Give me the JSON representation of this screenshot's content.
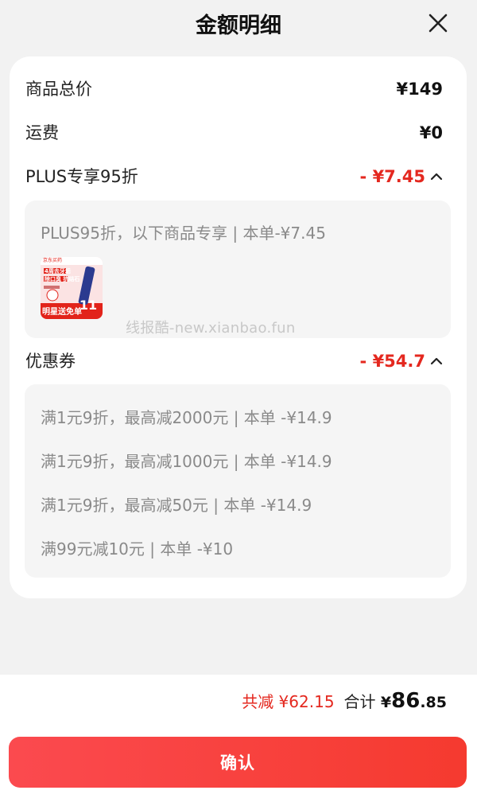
{
  "header": {
    "title": "金额明细"
  },
  "rows": {
    "goods_total": {
      "label": "商品总价",
      "value": "¥149"
    },
    "shipping": {
      "label": "运费",
      "value": "¥0"
    },
    "plus": {
      "label": "PLUS专享95折",
      "value": "- ¥7.45",
      "detail": "PLUS95折，以下商品专享 | 本单-¥7.45",
      "thumb": {
        "store": "京东买药",
        "badge": "4周去牙垢",
        "line2": "除口臭 抗结石",
        "promo": "明星送免单",
        "big": "11"
      }
    },
    "coupon": {
      "label": "优惠券",
      "value": "- ¥54.7",
      "items": [
        "满1元9折，最高减2000元 | 本单 -¥14.9",
        "满1元9折，最高减1000元 | 本单 -¥14.9",
        "满1元9折，最高减50元 | 本单 -¥14.9",
        "满99元减10元 | 本单 -¥10"
      ]
    }
  },
  "watermark": "线报酷-new.xianbao.fun",
  "footer": {
    "saved": "共减 ¥62.15",
    "total_label": "合计",
    "currency": "¥",
    "total_int": "86",
    "total_dec": ".85",
    "confirm_label": "确认"
  },
  "colors": {
    "accent": "#e4281f",
    "button": "#f8453e"
  }
}
